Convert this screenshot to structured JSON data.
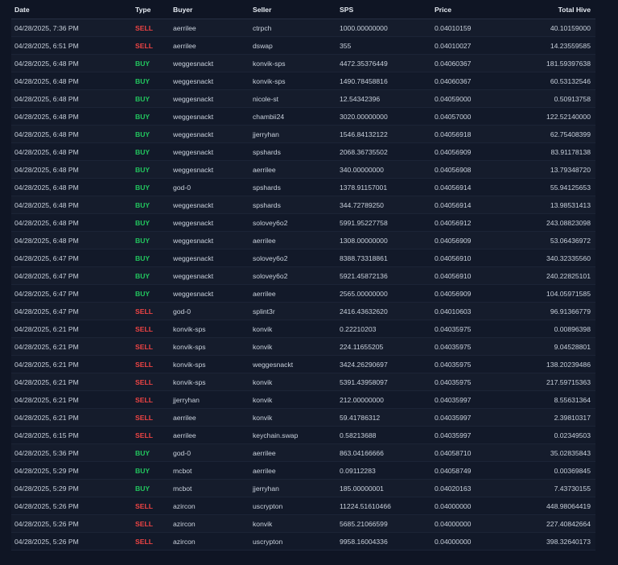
{
  "table": {
    "headers": {
      "date": "Date",
      "type": "Type",
      "buyer": "Buyer",
      "seller": "Seller",
      "sps": "SPS",
      "price": "Price",
      "total_hive": "Total Hive"
    },
    "rows": [
      {
        "date": "04/28/2025, 7:36 PM",
        "type": "SELL",
        "buyer": "aerrilee",
        "seller": "ctrpch",
        "sps": "1000.00000000",
        "price": "0.04010159",
        "total_hive": "40.10159000"
      },
      {
        "date": "04/28/2025, 6:51 PM",
        "type": "SELL",
        "buyer": "aerrilee",
        "seller": "dswap",
        "sps": "355",
        "price": "0.04010027",
        "total_hive": "14.23559585"
      },
      {
        "date": "04/28/2025, 6:48 PM",
        "type": "BUY",
        "buyer": "weggesnackt",
        "seller": "konvik-sps",
        "sps": "4472.35376449",
        "price": "0.04060367",
        "total_hive": "181.59397638"
      },
      {
        "date": "04/28/2025, 6:48 PM",
        "type": "BUY",
        "buyer": "weggesnackt",
        "seller": "konvik-sps",
        "sps": "1490.78458816",
        "price": "0.04060367",
        "total_hive": "60.53132546"
      },
      {
        "date": "04/28/2025, 6:48 PM",
        "type": "BUY",
        "buyer": "weggesnackt",
        "seller": "nicole-st",
        "sps": "12.54342396",
        "price": "0.04059000",
        "total_hive": "0.50913758"
      },
      {
        "date": "04/28/2025, 6:48 PM",
        "type": "BUY",
        "buyer": "weggesnackt",
        "seller": "chambii24",
        "sps": "3020.00000000",
        "price": "0.04057000",
        "total_hive": "122.52140000"
      },
      {
        "date": "04/28/2025, 6:48 PM",
        "type": "BUY",
        "buyer": "weggesnackt",
        "seller": "jjerryhan",
        "sps": "1546.84132122",
        "price": "0.04056918",
        "total_hive": "62.75408399"
      },
      {
        "date": "04/28/2025, 6:48 PM",
        "type": "BUY",
        "buyer": "weggesnackt",
        "seller": "spshards",
        "sps": "2068.36735502",
        "price": "0.04056909",
        "total_hive": "83.91178138"
      },
      {
        "date": "04/28/2025, 6:48 PM",
        "type": "BUY",
        "buyer": "weggesnackt",
        "seller": "aerrilee",
        "sps": "340.00000000",
        "price": "0.04056908",
        "total_hive": "13.79348720"
      },
      {
        "date": "04/28/2025, 6:48 PM",
        "type": "BUY",
        "buyer": "god-0",
        "seller": "spshards",
        "sps": "1378.91157001",
        "price": "0.04056914",
        "total_hive": "55.94125653"
      },
      {
        "date": "04/28/2025, 6:48 PM",
        "type": "BUY",
        "buyer": "weggesnackt",
        "seller": "spshards",
        "sps": "344.72789250",
        "price": "0.04056914",
        "total_hive": "13.98531413"
      },
      {
        "date": "04/28/2025, 6:48 PM",
        "type": "BUY",
        "buyer": "weggesnackt",
        "seller": "solovey6o2",
        "sps": "5991.95227758",
        "price": "0.04056912",
        "total_hive": "243.08823098"
      },
      {
        "date": "04/28/2025, 6:48 PM",
        "type": "BUY",
        "buyer": "weggesnackt",
        "seller": "aerrilee",
        "sps": "1308.00000000",
        "price": "0.04056909",
        "total_hive": "53.06436972"
      },
      {
        "date": "04/28/2025, 6:47 PM",
        "type": "BUY",
        "buyer": "weggesnackt",
        "seller": "solovey6o2",
        "sps": "8388.73318861",
        "price": "0.04056910",
        "total_hive": "340.32335560"
      },
      {
        "date": "04/28/2025, 6:47 PM",
        "type": "BUY",
        "buyer": "weggesnackt",
        "seller": "solovey6o2",
        "sps": "5921.45872136",
        "price": "0.04056910",
        "total_hive": "240.22825101"
      },
      {
        "date": "04/28/2025, 6:47 PM",
        "type": "BUY",
        "buyer": "weggesnackt",
        "seller": "aerrilee",
        "sps": "2565.00000000",
        "price": "0.04056909",
        "total_hive": "104.05971585"
      },
      {
        "date": "04/28/2025, 6:47 PM",
        "type": "SELL",
        "buyer": "god-0",
        "seller": "splint3r",
        "sps": "2416.43632620",
        "price": "0.04010603",
        "total_hive": "96.91366779"
      },
      {
        "date": "04/28/2025, 6:21 PM",
        "type": "SELL",
        "buyer": "konvik-sps",
        "seller": "konvik",
        "sps": "0.22210203",
        "price": "0.04035975",
        "total_hive": "0.00896398"
      },
      {
        "date": "04/28/2025, 6:21 PM",
        "type": "SELL",
        "buyer": "konvik-sps",
        "seller": "konvik",
        "sps": "224.11655205",
        "price": "0.04035975",
        "total_hive": "9.04528801"
      },
      {
        "date": "04/28/2025, 6:21 PM",
        "type": "SELL",
        "buyer": "konvik-sps",
        "seller": "weggesnackt",
        "sps": "3424.26290697",
        "price": "0.04035975",
        "total_hive": "138.20239486"
      },
      {
        "date": "04/28/2025, 6:21 PM",
        "type": "SELL",
        "buyer": "konvik-sps",
        "seller": "konvik",
        "sps": "5391.43958097",
        "price": "0.04035975",
        "total_hive": "217.59715363"
      },
      {
        "date": "04/28/2025, 6:21 PM",
        "type": "SELL",
        "buyer": "jjerryhan",
        "seller": "konvik",
        "sps": "212.00000000",
        "price": "0.04035997",
        "total_hive": "8.55631364"
      },
      {
        "date": "04/28/2025, 6:21 PM",
        "type": "SELL",
        "buyer": "aerrilee",
        "seller": "konvik",
        "sps": "59.41786312",
        "price": "0.04035997",
        "total_hive": "2.39810317"
      },
      {
        "date": "04/28/2025, 6:15 PM",
        "type": "SELL",
        "buyer": "aerrilee",
        "seller": "keychain.swap",
        "sps": "0.58213688",
        "price": "0.04035997",
        "total_hive": "0.02349503"
      },
      {
        "date": "04/28/2025, 5:36 PM",
        "type": "BUY",
        "buyer": "god-0",
        "seller": "aerrilee",
        "sps": "863.04166666",
        "price": "0.04058710",
        "total_hive": "35.02835843"
      },
      {
        "date": "04/28/2025, 5:29 PM",
        "type": "BUY",
        "buyer": "mcbot",
        "seller": "aerrilee",
        "sps": "0.09112283",
        "price": "0.04058749",
        "total_hive": "0.00369845"
      },
      {
        "date": "04/28/2025, 5:29 PM",
        "type": "BUY",
        "buyer": "mcbot",
        "seller": "jjerryhan",
        "sps": "185.00000001",
        "price": "0.04020163",
        "total_hive": "7.43730155"
      },
      {
        "date": "04/28/2025, 5:26 PM",
        "type": "SELL",
        "buyer": "azircon",
        "seller": "uscrypton",
        "sps": "11224.51610466",
        "price": "0.04000000",
        "total_hive": "448.98064419"
      },
      {
        "date": "04/28/2025, 5:26 PM",
        "type": "SELL",
        "buyer": "azircon",
        "seller": "konvik",
        "sps": "5685.21066599",
        "price": "0.04000000",
        "total_hive": "227.40842664"
      },
      {
        "date": "04/28/2025, 5:26 PM",
        "type": "SELL",
        "buyer": "azircon",
        "seller": "uscrypton",
        "sps": "9958.16004336",
        "price": "0.04000000",
        "total_hive": "398.32640173"
      }
    ]
  },
  "colors": {
    "background": "#0f1524",
    "sell": "#ef4444",
    "buy": "#22c55e"
  }
}
